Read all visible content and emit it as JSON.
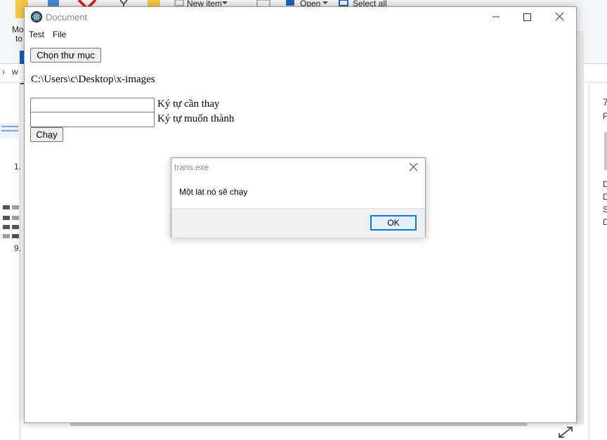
{
  "background": {
    "ribbon": {
      "new_item_label": "New item",
      "open_label": "Open",
      "select_all_label": "Select all",
      "move_to_label_1": "Mo",
      "move_to_label_2": "to"
    },
    "address_chevron": "›",
    "address_text": "w",
    "item_label_1": "1.",
    "item_label_2": "9.",
    "details_fragments": [
      "7",
      "P",
      "D",
      "D",
      "S",
      "D"
    ]
  },
  "window": {
    "title": "Document",
    "menu": [
      "Test",
      "File"
    ],
    "minimize_glyph": "—",
    "maximize_glyph": "☐",
    "close_glyph": "✕"
  },
  "form": {
    "choose_folder_label": "Chọn thư mục",
    "folder_path": "C:\\Users\\c\\Desktop\\x-images",
    "find_value": "",
    "find_label": "Ký tự cần thay",
    "replace_value": "",
    "replace_label": "Ký tự muốn thành",
    "run_label": "Chạy"
  },
  "dialog": {
    "title": "trans.exe",
    "message": "Một lát nó sẽ chạy",
    "ok_label": "OK"
  },
  "colors": {
    "accent": "#0078d7",
    "button_face": "#efefef",
    "dialog_footer": "#f0f0f0"
  }
}
